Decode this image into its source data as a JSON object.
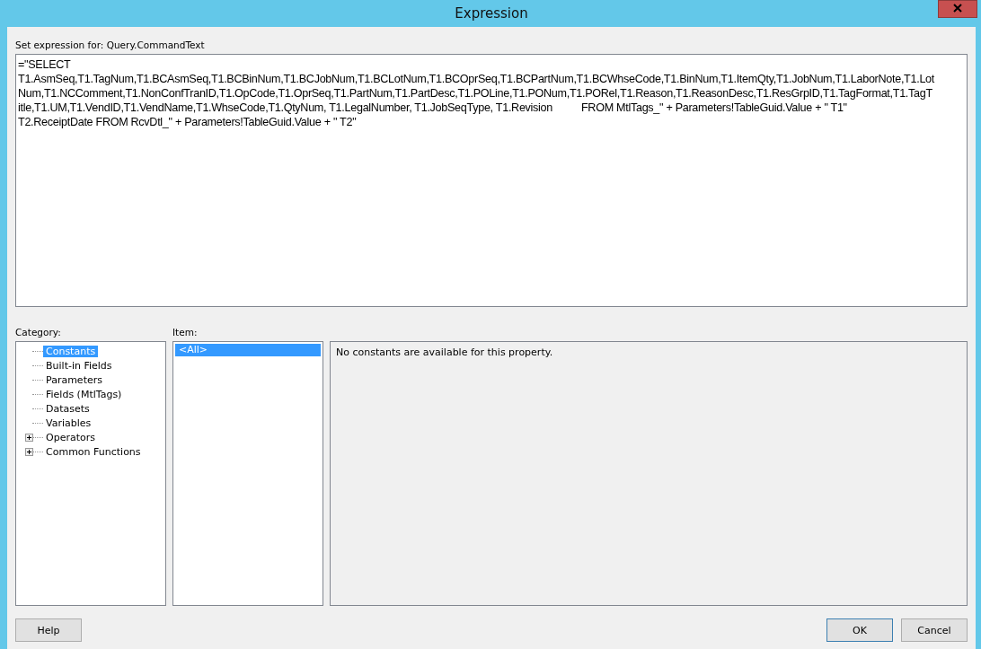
{
  "window": {
    "title": "Expression"
  },
  "expression_label": "Set expression for: Query.CommandText",
  "expression_lines": [
    "=\"SELECT",
    "T1.AsmSeq,T1.TagNum,T1.BCAsmSeq,T1.BCBinNum,T1.BCJobNum,T1.BCLotNum,T1.BCOprSeq,T1.BCPartNum,T1.BCWhseCode,T1.BinNum,T1.ItemQty,T1.JobNum,T1.LaborNote,T1.Lot",
    "Num,T1.NCComment,T1.NonConfTranID,T1.OpCode,T1.OprSeq,T1.PartNum,T1.PartDesc,T1.POLine,T1.PONum,T1.PORel,T1.Reason,T1.ReasonDesc,T1.ResGrpID,T1.TagFormat,T1.TagT",
    "itle,T1.UM,T1.VendID,T1.VendName,T1.WhseCode,T1.QtyNum, T1.LegalNumber, T1.JobSeqType, T1.Revision          FROM MtlTags_\" + Parameters!TableGuid.Value + \" T1\"",
    "T2.ReceiptDate FROM RcvDtl_\" + Parameters!TableGuid.Value + \" T2\""
  ],
  "category": {
    "label": "Category:",
    "items": [
      {
        "label": "Constants",
        "selected": true,
        "expandable": false
      },
      {
        "label": "Built-in Fields",
        "selected": false,
        "expandable": false
      },
      {
        "label": "Parameters",
        "selected": false,
        "expandable": false
      },
      {
        "label": "Fields (MtlTags)",
        "selected": false,
        "expandable": false
      },
      {
        "label": "Datasets",
        "selected": false,
        "expandable": false
      },
      {
        "label": "Variables",
        "selected": false,
        "expandable": false
      },
      {
        "label": "Operators",
        "selected": false,
        "expandable": true
      },
      {
        "label": "Common Functions",
        "selected": false,
        "expandable": true
      }
    ]
  },
  "item": {
    "label": "Item:",
    "items": [
      {
        "label": "<All>",
        "selected": true
      }
    ]
  },
  "description": "No constants are available for this property.",
  "buttons": {
    "left": [
      "Help"
    ],
    "right": [
      {
        "label": "OK",
        "default": true
      },
      {
        "label": "Cancel",
        "default": false
      }
    ]
  }
}
